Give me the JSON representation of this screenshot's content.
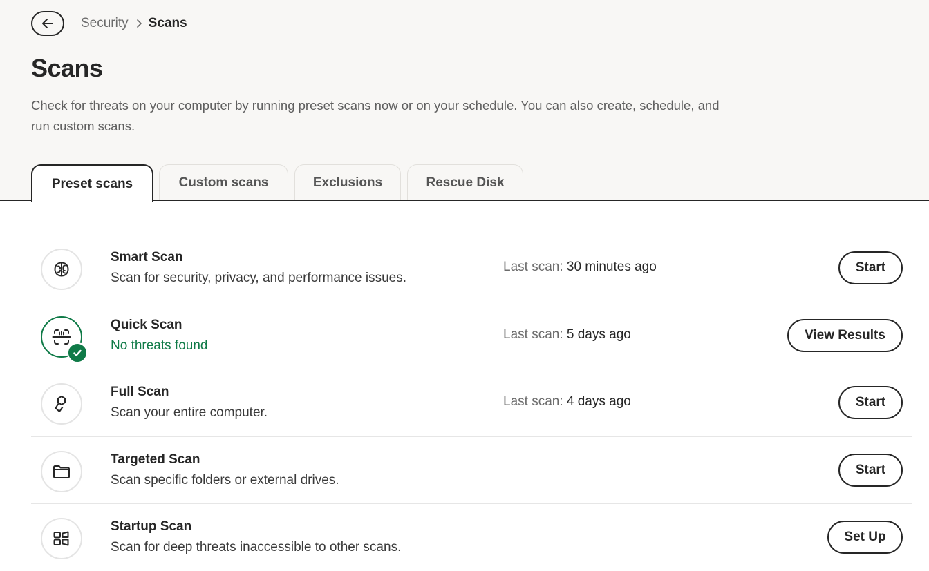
{
  "breadcrumb": {
    "parent": "Security",
    "separator_icon": "chevron-right-icon",
    "current": "Scans"
  },
  "back_icon": "arrow-left-icon",
  "page": {
    "title": "Scans",
    "description": "Check for threats on your computer by running preset scans now or on your schedule. You can also create, schedule, and run custom scans."
  },
  "tabs": [
    {
      "label": "Preset scans",
      "active": true
    },
    {
      "label": "Custom scans",
      "active": false
    },
    {
      "label": "Exclusions",
      "active": false
    },
    {
      "label": "Rescue Disk",
      "active": false
    }
  ],
  "last_scan_label": "Last scan:",
  "scans": [
    {
      "name": "Smart Scan",
      "description": "Scan for security, privacy, and performance issues.",
      "last_scan": "30 minutes ago",
      "action": "Start",
      "icon": "brain-icon"
    },
    {
      "name": "Quick Scan",
      "description": "No threats found",
      "last_scan": "5 days ago",
      "action": "View Results",
      "icon": "scan-frame-icon",
      "status_icon": "check-icon"
    },
    {
      "name": "Full Scan",
      "description": "Scan your entire computer.",
      "last_scan": "4 days ago",
      "action": "Start",
      "icon": "shapes-icon"
    },
    {
      "name": "Targeted Scan",
      "description": "Scan specific folders or external drives.",
      "action": "Start",
      "icon": "folder-icon"
    },
    {
      "name": "Startup Scan",
      "description": "Scan for deep threats inaccessible to other scans.",
      "action": "Set Up",
      "icon": "windows-icon"
    }
  ],
  "colors": {
    "success": "#0f7a47",
    "text": "#262626",
    "muted": "#6b6b6b",
    "header_bg": "#f8f7f5"
  }
}
